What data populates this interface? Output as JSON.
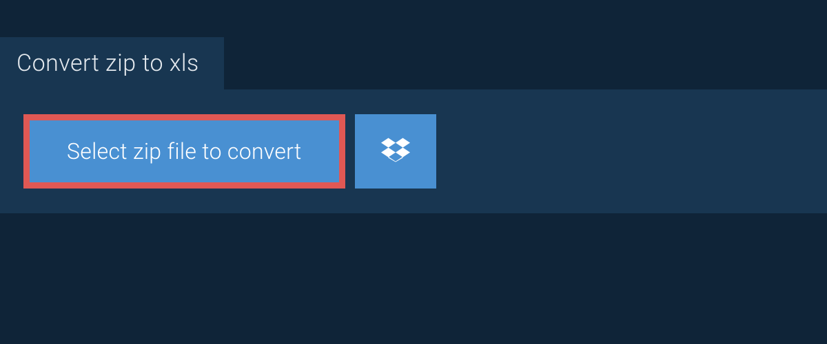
{
  "tab": {
    "title": "Convert zip to xls"
  },
  "upload": {
    "select_label": "Select zip file to convert",
    "dropbox_icon": "dropbox-icon"
  },
  "colors": {
    "background": "#0f2438",
    "panel": "#183651",
    "button": "#4990d2",
    "highlight_border": "#e05854",
    "text_light": "#e4e9ee",
    "text_white": "#ffffff"
  }
}
